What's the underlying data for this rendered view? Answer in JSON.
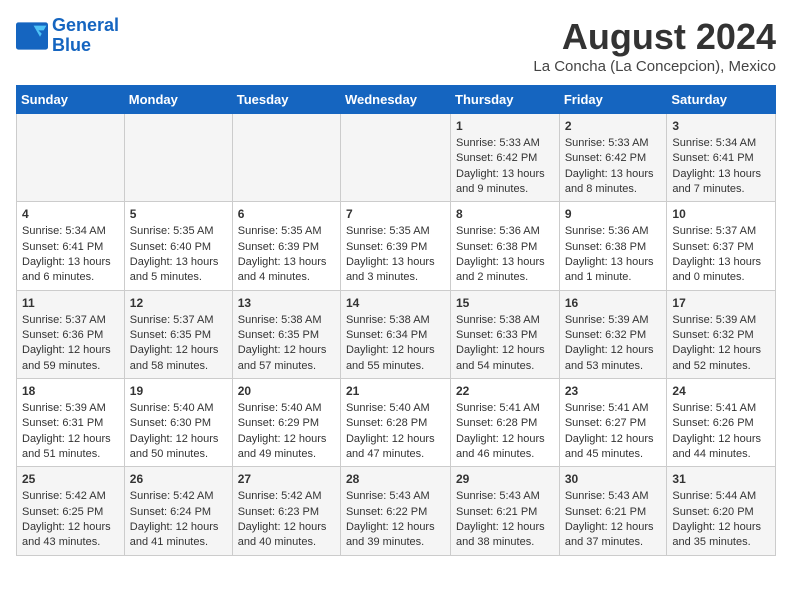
{
  "logo": {
    "line1": "General",
    "line2": "Blue"
  },
  "title": "August 2024",
  "location": "La Concha (La Concepcion), Mexico",
  "days_of_week": [
    "Sunday",
    "Monday",
    "Tuesday",
    "Wednesday",
    "Thursday",
    "Friday",
    "Saturday"
  ],
  "weeks": [
    [
      {
        "day": "",
        "content": ""
      },
      {
        "day": "",
        "content": ""
      },
      {
        "day": "",
        "content": ""
      },
      {
        "day": "",
        "content": ""
      },
      {
        "day": "1",
        "content": "Sunrise: 5:33 AM\nSunset: 6:42 PM\nDaylight: 13 hours and 9 minutes."
      },
      {
        "day": "2",
        "content": "Sunrise: 5:33 AM\nSunset: 6:42 PM\nDaylight: 13 hours and 8 minutes."
      },
      {
        "day": "3",
        "content": "Sunrise: 5:34 AM\nSunset: 6:41 PM\nDaylight: 13 hours and 7 minutes."
      }
    ],
    [
      {
        "day": "4",
        "content": "Sunrise: 5:34 AM\nSunset: 6:41 PM\nDaylight: 13 hours and 6 minutes."
      },
      {
        "day": "5",
        "content": "Sunrise: 5:35 AM\nSunset: 6:40 PM\nDaylight: 13 hours and 5 minutes."
      },
      {
        "day": "6",
        "content": "Sunrise: 5:35 AM\nSunset: 6:39 PM\nDaylight: 13 hours and 4 minutes."
      },
      {
        "day": "7",
        "content": "Sunrise: 5:35 AM\nSunset: 6:39 PM\nDaylight: 13 hours and 3 minutes."
      },
      {
        "day": "8",
        "content": "Sunrise: 5:36 AM\nSunset: 6:38 PM\nDaylight: 13 hours and 2 minutes."
      },
      {
        "day": "9",
        "content": "Sunrise: 5:36 AM\nSunset: 6:38 PM\nDaylight: 13 hours and 1 minute."
      },
      {
        "day": "10",
        "content": "Sunrise: 5:37 AM\nSunset: 6:37 PM\nDaylight: 13 hours and 0 minutes."
      }
    ],
    [
      {
        "day": "11",
        "content": "Sunrise: 5:37 AM\nSunset: 6:36 PM\nDaylight: 12 hours and 59 minutes."
      },
      {
        "day": "12",
        "content": "Sunrise: 5:37 AM\nSunset: 6:35 PM\nDaylight: 12 hours and 58 minutes."
      },
      {
        "day": "13",
        "content": "Sunrise: 5:38 AM\nSunset: 6:35 PM\nDaylight: 12 hours and 57 minutes."
      },
      {
        "day": "14",
        "content": "Sunrise: 5:38 AM\nSunset: 6:34 PM\nDaylight: 12 hours and 55 minutes."
      },
      {
        "day": "15",
        "content": "Sunrise: 5:38 AM\nSunset: 6:33 PM\nDaylight: 12 hours and 54 minutes."
      },
      {
        "day": "16",
        "content": "Sunrise: 5:39 AM\nSunset: 6:32 PM\nDaylight: 12 hours and 53 minutes."
      },
      {
        "day": "17",
        "content": "Sunrise: 5:39 AM\nSunset: 6:32 PM\nDaylight: 12 hours and 52 minutes."
      }
    ],
    [
      {
        "day": "18",
        "content": "Sunrise: 5:39 AM\nSunset: 6:31 PM\nDaylight: 12 hours and 51 minutes."
      },
      {
        "day": "19",
        "content": "Sunrise: 5:40 AM\nSunset: 6:30 PM\nDaylight: 12 hours and 50 minutes."
      },
      {
        "day": "20",
        "content": "Sunrise: 5:40 AM\nSunset: 6:29 PM\nDaylight: 12 hours and 49 minutes."
      },
      {
        "day": "21",
        "content": "Sunrise: 5:40 AM\nSunset: 6:28 PM\nDaylight: 12 hours and 47 minutes."
      },
      {
        "day": "22",
        "content": "Sunrise: 5:41 AM\nSunset: 6:28 PM\nDaylight: 12 hours and 46 minutes."
      },
      {
        "day": "23",
        "content": "Sunrise: 5:41 AM\nSunset: 6:27 PM\nDaylight: 12 hours and 45 minutes."
      },
      {
        "day": "24",
        "content": "Sunrise: 5:41 AM\nSunset: 6:26 PM\nDaylight: 12 hours and 44 minutes."
      }
    ],
    [
      {
        "day": "25",
        "content": "Sunrise: 5:42 AM\nSunset: 6:25 PM\nDaylight: 12 hours and 43 minutes."
      },
      {
        "day": "26",
        "content": "Sunrise: 5:42 AM\nSunset: 6:24 PM\nDaylight: 12 hours and 41 minutes."
      },
      {
        "day": "27",
        "content": "Sunrise: 5:42 AM\nSunset: 6:23 PM\nDaylight: 12 hours and 40 minutes."
      },
      {
        "day": "28",
        "content": "Sunrise: 5:43 AM\nSunset: 6:22 PM\nDaylight: 12 hours and 39 minutes."
      },
      {
        "day": "29",
        "content": "Sunrise: 5:43 AM\nSunset: 6:21 PM\nDaylight: 12 hours and 38 minutes."
      },
      {
        "day": "30",
        "content": "Sunrise: 5:43 AM\nSunset: 6:21 PM\nDaylight: 12 hours and 37 minutes."
      },
      {
        "day": "31",
        "content": "Sunrise: 5:44 AM\nSunset: 6:20 PM\nDaylight: 12 hours and 35 minutes."
      }
    ]
  ]
}
